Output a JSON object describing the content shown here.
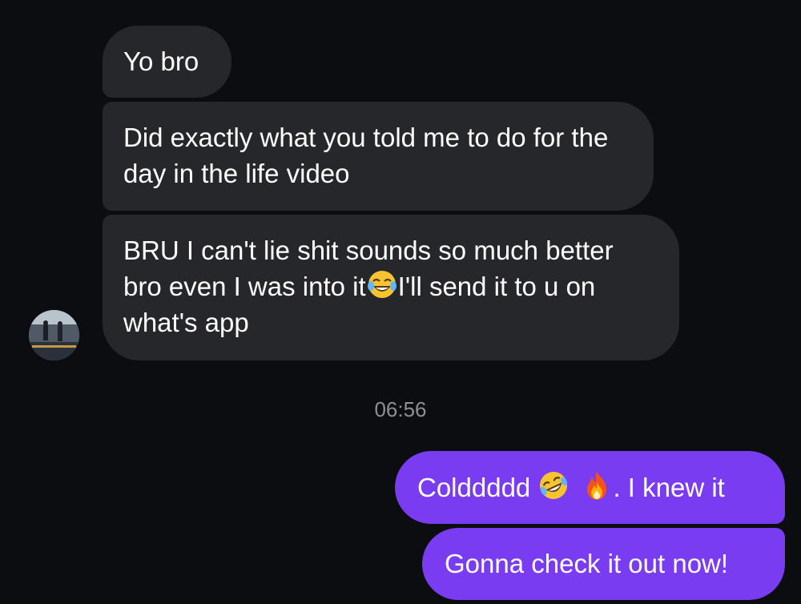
{
  "conversation": {
    "messages": [
      {
        "direction": "incoming",
        "text": "Yo bro"
      },
      {
        "direction": "incoming",
        "text": "Did exactly what you told me to do for the day in the life video"
      },
      {
        "direction": "incoming",
        "text_before_emoji": "BRU I can't lie shit sounds so much better bro even I was into it",
        "emoji": "face-with-tears-of-joy-emoji",
        "text_after_emoji": "I'll send it to u on what's app"
      },
      {
        "direction": "outgoing",
        "text_before_emoji": "Colddddd ",
        "emojis": [
          "rolling-on-the-floor-laughing-emoji",
          "fire-emoji"
        ],
        "text_after_emoji": ". I knew it"
      },
      {
        "direction": "outgoing",
        "text": "Gonna check it out now!"
      }
    ],
    "timestamp": "06:56"
  },
  "colors": {
    "background": "#0c0d10",
    "incoming_bubble": "#26272b",
    "outgoing_bubble": "#7a3cf0",
    "timestamp_text": "#8e8f93"
  },
  "icons": {
    "contact_avatar": "avatar"
  }
}
